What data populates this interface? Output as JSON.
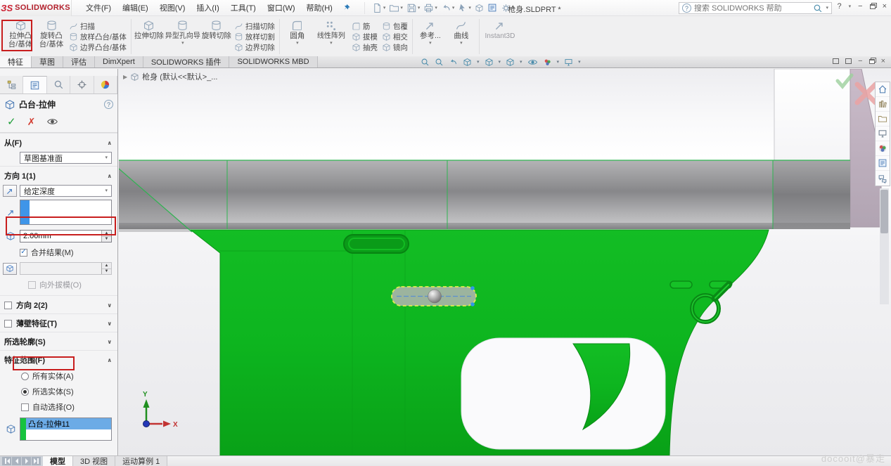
{
  "app": {
    "logo_mark": "ЗS",
    "logo_text": "SOLIDWORKS",
    "document_title": "枪身.SLDPRT *",
    "search_placeholder": "搜索 SOLIDWORKS 帮助",
    "help_label": "?"
  },
  "menus": [
    "文件(F)",
    "编辑(E)",
    "视图(V)",
    "插入(I)",
    "工具(T)",
    "窗口(W)",
    "帮助(H)"
  ],
  "ribbon": {
    "extrude_boss": "拉伸凸台/基体",
    "revolve_boss": "旋转凸台/基体",
    "sweep": "扫描",
    "loft_boss": "放样凸台/基体",
    "boundary_boss": "边界凸台/基体",
    "extrude_cut": "拉伸切除",
    "hole_wizard": "异型孔向导",
    "revolve_cut": "旋转切除",
    "sweep_cut": "扫描切除",
    "loft_cut": "放样切割",
    "boundary_cut": "边界切除",
    "fillet": "圆角",
    "linear_pattern": "线性阵列",
    "rib": "筋",
    "draft": "拔模",
    "shell": "抽壳",
    "wrap": "包覆",
    "intersect": "相交",
    "mirror": "镜向",
    "reference_geometry": "参考...",
    "curves": "曲线",
    "instant3d": "Instant3D"
  },
  "command_tabs": {
    "items": [
      "特征",
      "草图",
      "评估",
      "DimXpert",
      "SOLIDWORKS 插件",
      "SOLIDWORKS MBD"
    ],
    "active": "特征"
  },
  "property_manager": {
    "title": "凸台-拉伸",
    "from_label": "从(F)",
    "from_value": "草图基准面",
    "direction1_label": "方向 1(1)",
    "end_condition": "给定深度",
    "depth_value": "2.00mm",
    "merge_result_label": "合并结果(M)",
    "merge_result_checked": true,
    "draft_outward_label": "向外拔模(O)",
    "direction2_label": "方向 2(2)",
    "thin_feature_label": "薄壁特征(T)",
    "selected_contours_label": "所选轮廓(S)",
    "feature_scope_label": "特征范围(F)",
    "scope_all_bodies": "所有实体(A)",
    "scope_selected_bodies": "所选实体(S)",
    "scope_auto_select": "自动选择(O)",
    "scope_selected_option": "所选实体(S)",
    "body_list": [
      "凸台-拉伸11"
    ]
  },
  "viewport": {
    "feature_tree_node": "枪身 (默认<<默认>_...",
    "axis_x_label": "X",
    "axis_y_label": "Y",
    "watermark": "docooit@暴走"
  },
  "status_bar": {
    "tabs": [
      "模型",
      "3D 视图",
      "运动算例 1"
    ],
    "active_tab": "模型"
  },
  "colors": {
    "model_green": "#0db51f",
    "selection_blue": "#4a9de8",
    "annotation_red": "#c81e1e"
  }
}
